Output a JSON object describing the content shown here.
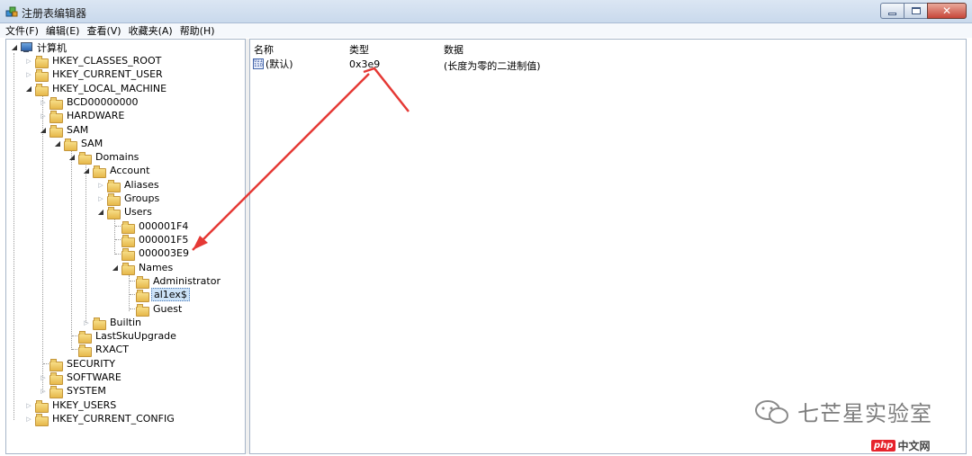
{
  "window": {
    "title": "注册表编辑器",
    "app_icon": "regedit-icon"
  },
  "menu": [
    "文件(F)",
    "编辑(E)",
    "查看(V)",
    "收藏夹(A)",
    "帮助(H)"
  ],
  "tree": {
    "root": "计算机",
    "hkcr": "HKEY_CLASSES_ROOT",
    "hkcu": "HKEY_CURRENT_USER",
    "hklm": "HKEY_LOCAL_MACHINE",
    "bcd": "BCD00000000",
    "hardware": "HARDWARE",
    "sam1": "SAM",
    "sam2": "SAM",
    "domains": "Domains",
    "account": "Account",
    "aliases": "Aliases",
    "groups": "Groups",
    "users": "Users",
    "u1": "000001F4",
    "u2": "000001F5",
    "u3": "000003E9",
    "names": "Names",
    "n1": "Administrator",
    "n2": "al1ex$",
    "n3": "Guest",
    "builtin": "Builtin",
    "lastsku": "LastSkuUpgrade",
    "rxact": "RXACT",
    "security": "SECURITY",
    "software": "SOFTWARE",
    "system": "SYSTEM",
    "hku": "HKEY_USERS",
    "hkcc": "HKEY_CURRENT_CONFIG"
  },
  "list": {
    "columns": [
      "名称",
      "类型",
      "数据"
    ],
    "rows": [
      {
        "name": "(默认)",
        "type": "0x3e9",
        "data": "(长度为零的二进制值)"
      }
    ]
  },
  "watermark": {
    "text": "七芒星实验室",
    "logo_badge": "php",
    "logo_text": "中文网"
  },
  "colors": {
    "arrow": "#e53935",
    "selection": "#cde3f8"
  }
}
